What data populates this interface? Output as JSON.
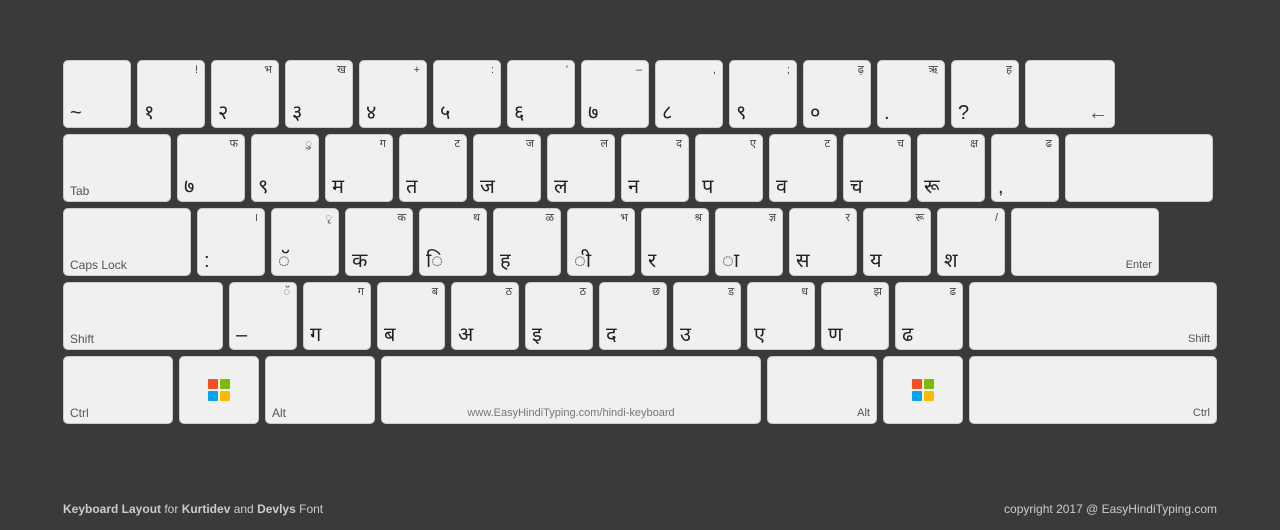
{
  "keyboard": {
    "title": "Keyboard Layout for Kurtidev and Devlys Font",
    "copyright": "copyright 2017 @ EasyHindiTyping.com",
    "rows": [
      {
        "keys": [
          {
            "top": "",
            "main": "~",
            "label": "",
            "width": "normal"
          },
          {
            "top": "!",
            "main": "१",
            "label": "",
            "width": "normal"
          },
          {
            "top": "भ",
            "main": "२",
            "label": "",
            "width": "normal"
          },
          {
            "top": "ख",
            "main": "३",
            "label": "",
            "width": "normal"
          },
          {
            "top": "+",
            "main": "४",
            "label": "",
            "width": "normal"
          },
          {
            "top": ":",
            "main": "५",
            "label": "",
            "width": "normal"
          },
          {
            "top": "'",
            "main": "६",
            "label": "",
            "width": "normal"
          },
          {
            "top": "–",
            "main": "७",
            "label": "",
            "width": "normal"
          },
          {
            "top": ",",
            "main": "८",
            "label": "",
            "width": "normal"
          },
          {
            "top": ";",
            "main": "९",
            "label": "",
            "width": "normal"
          },
          {
            "top": "ढ़",
            "main": "०",
            "label": "",
            "width": "normal"
          },
          {
            "top": "ऋ",
            "main": ".",
            "label": "",
            "width": "normal"
          },
          {
            "top": "ह",
            "main": "?",
            "label": "",
            "width": "normal"
          },
          {
            "top": "←",
            "main": "",
            "label": "",
            "width": "backspace"
          }
        ]
      },
      {
        "keys": [
          {
            "top": "",
            "main": "",
            "label": "Tab",
            "width": "tab"
          },
          {
            "top": "फ",
            "main": "७",
            "label": "",
            "width": "normal"
          },
          {
            "top": "ु",
            "main": "९",
            "label": "",
            "width": "normal"
          },
          {
            "top": "ग",
            "main": "म",
            "label": "",
            "width": "normal"
          },
          {
            "top": "ट",
            "main": "त",
            "label": "",
            "width": "normal"
          },
          {
            "top": "ज",
            "main": "ज",
            "label": "",
            "width": "normal"
          },
          {
            "top": "ल",
            "main": "ल",
            "label": "",
            "width": "normal"
          },
          {
            "top": "द",
            "main": "न",
            "label": "",
            "width": "normal"
          },
          {
            "top": "ए",
            "main": "प",
            "label": "",
            "width": "normal"
          },
          {
            "top": "ट",
            "main": "व",
            "label": "",
            "width": "normal"
          },
          {
            "top": "च",
            "main": "च",
            "label": "",
            "width": "normal"
          },
          {
            "top": "क्ष",
            "main": "रू",
            "label": "",
            "width": "normal"
          },
          {
            "top": "ढ",
            "main": ",",
            "label": "",
            "width": "normal"
          },
          {
            "top": "",
            "main": "",
            "label": "",
            "width": "enter-top"
          }
        ]
      },
      {
        "keys": [
          {
            "top": "",
            "main": "",
            "label": "Caps Lock",
            "width": "caps"
          },
          {
            "top": "।",
            "main": ":",
            "label": "",
            "width": "normal"
          },
          {
            "top": "ृ",
            "main": "ॅ",
            "label": "",
            "width": "normal"
          },
          {
            "top": "क",
            "main": "क",
            "label": "",
            "width": "normal"
          },
          {
            "top": "थ",
            "main": "ि",
            "label": "",
            "width": "normal"
          },
          {
            "top": "ळ",
            "main": "ह",
            "label": "",
            "width": "normal"
          },
          {
            "top": "भ",
            "main": "ी",
            "label": "",
            "width": "normal"
          },
          {
            "top": "श्र",
            "main": "र",
            "label": "",
            "width": "normal"
          },
          {
            "top": "ज्ञ",
            "main": "ा",
            "label": "",
            "width": "normal"
          },
          {
            "top": "र",
            "main": "स",
            "label": "",
            "width": "normal"
          },
          {
            "top": "रू",
            "main": "य",
            "label": "",
            "width": "normal"
          },
          {
            "top": "/",
            "main": "श",
            "label": "",
            "width": "normal"
          },
          {
            "top": "",
            "main": "",
            "label": "Enter",
            "width": "enter"
          }
        ]
      },
      {
        "keys": [
          {
            "top": "",
            "main": "",
            "label": "Shift",
            "width": "shift-l"
          },
          {
            "top": "ॅ",
            "main": "–",
            "label": "",
            "width": "normal"
          },
          {
            "top": "ग",
            "main": "ग",
            "label": "",
            "width": "normal"
          },
          {
            "top": "ब",
            "main": "ब",
            "label": "",
            "width": "normal"
          },
          {
            "top": "ठ",
            "main": "अ",
            "label": "",
            "width": "normal"
          },
          {
            "top": "ठ",
            "main": "इ",
            "label": "",
            "width": "normal"
          },
          {
            "top": "छ",
            "main": "द",
            "label": "",
            "width": "normal"
          },
          {
            "top": "ड",
            "main": "उ",
            "label": "",
            "width": "normal"
          },
          {
            "top": "ध",
            "main": "ए",
            "label": "",
            "width": "normal"
          },
          {
            "top": "झ",
            "main": "ण",
            "label": "",
            "width": "normal"
          },
          {
            "top": "ढ",
            "main": "ढ",
            "label": "",
            "width": "normal"
          },
          {
            "top": "",
            "main": "",
            "label": "Shift",
            "width": "shift-r"
          }
        ]
      },
      {
        "keys": [
          {
            "top": "",
            "main": "",
            "label": "Ctrl",
            "width": "ctrl"
          },
          {
            "top": "",
            "main": "win",
            "label": "",
            "width": "win"
          },
          {
            "top": "",
            "main": "",
            "label": "Alt",
            "width": "alt"
          },
          {
            "top": "",
            "main": "space",
            "label": "www.EasyHindiTyping.com/hindi-keyboard",
            "width": "space"
          },
          {
            "top": "",
            "main": "",
            "label": "Alt",
            "width": "alt"
          },
          {
            "top": "",
            "main": "win",
            "label": "",
            "width": "win"
          },
          {
            "top": "",
            "main": "",
            "label": "Ctrl",
            "width": "ctrl"
          }
        ]
      }
    ]
  }
}
